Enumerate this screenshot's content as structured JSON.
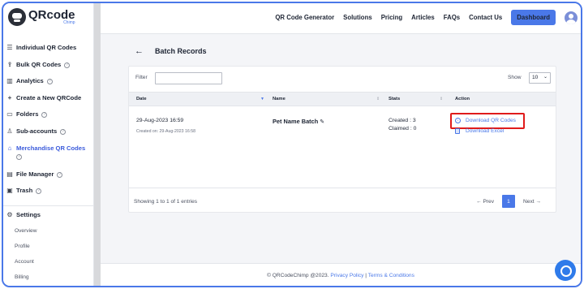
{
  "app": {
    "logo_text": "QRcode",
    "logo_sub": "Chimp"
  },
  "topnav": {
    "items": [
      "QR Code Generator",
      "Solutions",
      "Pricing",
      "Articles",
      "FAQs",
      "Contact Us"
    ],
    "dashboard_label": "Dashboard"
  },
  "sidebar": {
    "items": [
      {
        "label": "Individual QR Codes",
        "icon": "list-icon",
        "help": false
      },
      {
        "label": "Bulk QR Codes",
        "icon": "upload-icon",
        "help": true
      },
      {
        "label": "Analytics",
        "icon": "bar-chart-icon",
        "help": true
      },
      {
        "label": "Create a New QRCode",
        "icon": "plus-icon",
        "help": false
      },
      {
        "label": "Folders",
        "icon": "folder-icon",
        "help": true
      },
      {
        "label": "Sub-accounts",
        "icon": "user-icon",
        "help": true
      },
      {
        "label": "Merchandise QR Codes",
        "icon": "shop-icon",
        "help": true
      },
      {
        "label": "File Manager",
        "icon": "file-icon",
        "help": true
      },
      {
        "label": "Trash",
        "icon": "trash-icon",
        "help": true
      }
    ],
    "settings": {
      "label": "Settings",
      "icon": "gear-icon"
    },
    "sub_items": [
      "Overview",
      "Profile",
      "Account",
      "Billing"
    ],
    "help_glyph": "?"
  },
  "main": {
    "back_arrow": "←",
    "title": "Batch Records",
    "filter_label": "Filter",
    "show_label": "Show",
    "show_value": "10",
    "columns": [
      "Date",
      "Name",
      "Stats",
      "Action"
    ],
    "row": {
      "date": "29-Aug-2023 16:59",
      "created_on": "Created on: 29-Aug-2023 16:58",
      "name": "Pet Name Batch",
      "created": "Created : 3",
      "claimed": "Claimed : 0",
      "download_qr": "Download QR Codes",
      "download_excel": "Download Excel"
    },
    "entries_text": "Showing 1 to 1 of 1 entries",
    "pager": {
      "prev": "← Prev",
      "page": "1",
      "next": "Next →"
    }
  },
  "footer": {
    "copyright": "© QRCodeChimp @2023.",
    "privacy": "Privacy Policy",
    "separator": "|",
    "terms": "Terms & Conditions"
  },
  "colors": {
    "accent": "#4a78e8",
    "highlight": "#e01b1b",
    "frame": "#4a78e8"
  }
}
